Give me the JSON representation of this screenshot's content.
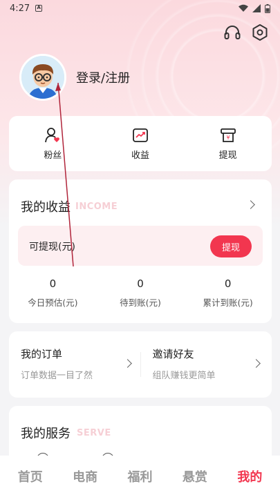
{
  "status_bar": {
    "time": "4:27",
    "notification_icon": "A"
  },
  "header": {
    "icons": [
      "headset-icon",
      "settings-icon"
    ]
  },
  "profile": {
    "login_label": "登录/注册"
  },
  "quick_actions": [
    {
      "icon": "fans-icon",
      "label": "粉丝"
    },
    {
      "icon": "earnings-chart-icon",
      "label": "收益"
    },
    {
      "icon": "withdraw-icon",
      "label": "提现"
    }
  ],
  "income": {
    "title": "我的收益",
    "ghost": "INCOME",
    "withdrawable_label": "可提现(元)",
    "withdraw_button": "提现",
    "stats": [
      {
        "value": "0",
        "label": "今日预估(元)"
      },
      {
        "value": "0",
        "label": "待到账(元)"
      },
      {
        "value": "0",
        "label": "累计到账(元)"
      }
    ]
  },
  "orders": {
    "left": {
      "title": "我的订单",
      "subtitle": "订单数据一目了然"
    },
    "right": {
      "title": "邀请好友",
      "subtitle": "组队赚钱更简单"
    }
  },
  "services": {
    "title": "我的服务",
    "ghost": "SERVE"
  },
  "tabbar": {
    "items": [
      "首页",
      "电商",
      "福利",
      "悬赏",
      "我的"
    ],
    "active_index": 4
  },
  "colors": {
    "accent": "#f2364f",
    "pink_bg": "#fbd9de"
  }
}
